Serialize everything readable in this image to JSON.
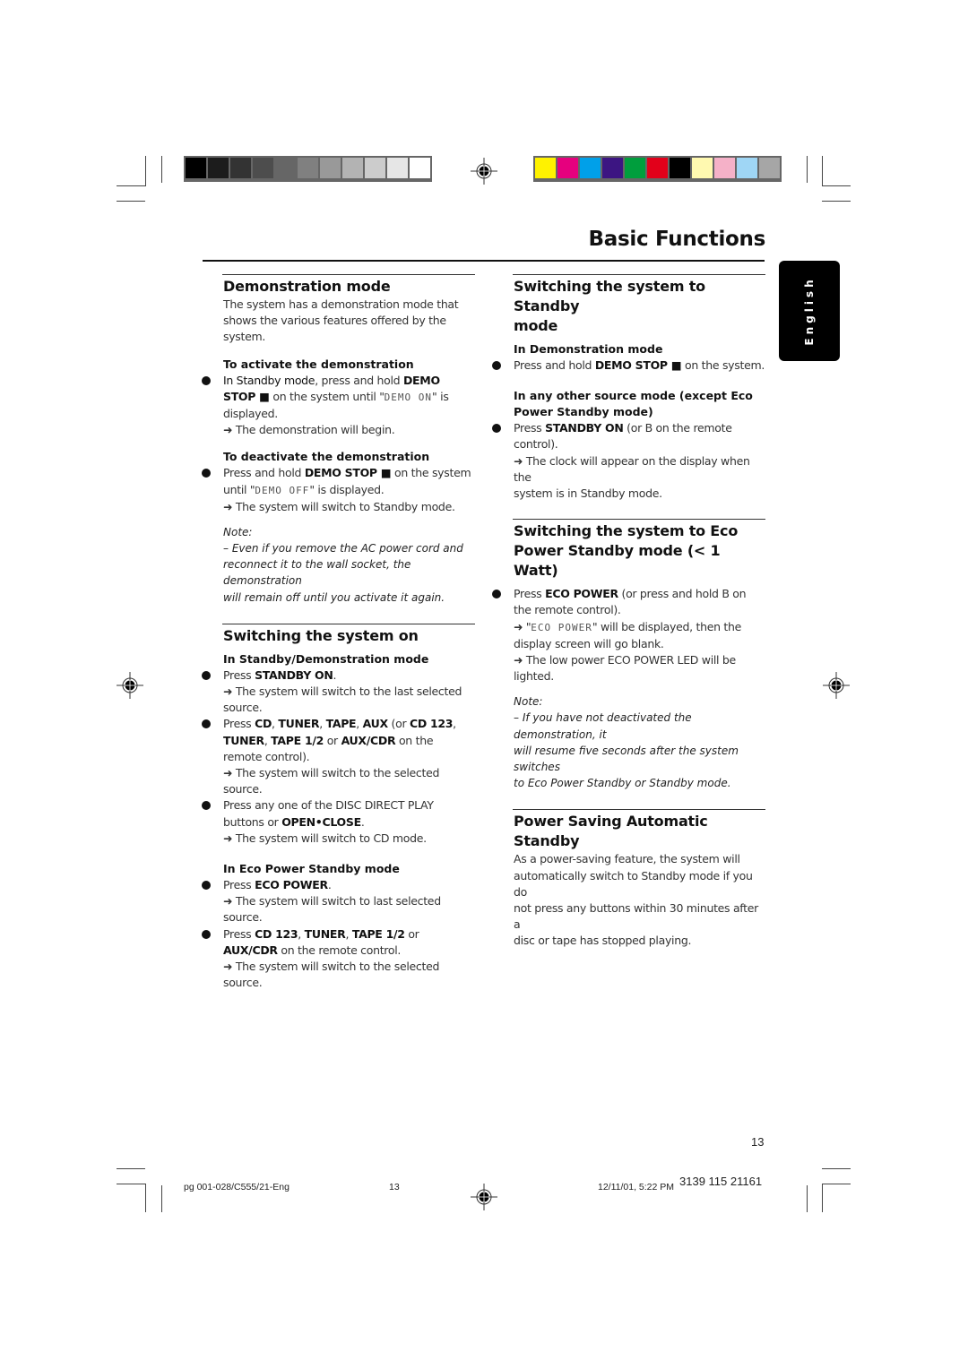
{
  "color_bars": {
    "grayscale": [
      "#000000",
      "#1c1c1c",
      "#333333",
      "#4d4d4d",
      "#666666",
      "#808080",
      "#999999",
      "#b3b3b3",
      "#cccccc",
      "#e6e6e6",
      "#ffffff"
    ],
    "process": [
      "#fff200",
      "#e6007e",
      "#00a0e9",
      "#3c1582",
      "#009e3d",
      "#e2001a",
      "#000000",
      "#fff9b0",
      "#f5b1c8",
      "#9fd6f5",
      "#a6a6a6"
    ]
  },
  "header": {
    "title": "Basic Functions"
  },
  "language_tab": {
    "label": "English"
  },
  "left_column": {
    "demo": {
      "title": "Demonstration mode",
      "intro": [
        "The system has a demonstration mode that",
        "shows the various features offered by the system."
      ],
      "activate": {
        "heading": "To activate the demonstration",
        "line1_a": "In Standby mode",
        "line1_b": ", press and hold ",
        "line1_c": "DEMO",
        "line2_a": "STOP ",
        "line2_b": "■",
        "line2_c": " on the system until \"",
        "line2_lcd": "DEMO ON",
        "line2_d": "\" is",
        "line3": "displayed.",
        "result": "➜ The demonstration will begin."
      },
      "deactivate": {
        "heading": "To deactivate the demonstration",
        "line1_a": "Press and hold ",
        "line1_b": "DEMO STOP ",
        "line1_c": "■",
        "line1_d": " on the system",
        "line2_a": "until \"",
        "line2_lcd": "DEMO OFF",
        "line2_b": "\" is displayed.",
        "result": "➜ The system will switch to Standby mode."
      },
      "note_label": "Note:",
      "note_lines": [
        "–  Even if you remove the AC power cord and",
        "reconnect it to the wall socket, the demonstration",
        "will remain off until you activate it again."
      ]
    },
    "switch_on": {
      "title": "Switching the system on",
      "standby_heading": "In Standby/Demonstration mode",
      "b1_a": "Press ",
      "b1_b": "STANDBY ON",
      "b1_c": ".",
      "b1_result1": "➜ The system will switch to the last selected",
      "b1_result2": "source.",
      "b2_l1_a": "Press ",
      "b2_l1_b": "CD",
      "b2_l1_c": ", ",
      "b2_l1_d": "TUNER",
      "b2_l1_e": ", ",
      "b2_l1_f": "TAPE",
      "b2_l1_g": ", ",
      "b2_l1_h": "AUX",
      "b2_l1_i": " (or ",
      "b2_l1_j": "CD 123",
      "b2_l1_k": ",",
      "b2_l2_a": "TUNER",
      "b2_l2_b": ", ",
      "b2_l2_c": "TAPE 1/2",
      "b2_l2_d": " or ",
      "b2_l2_e": "AUX/CDR",
      "b2_l2_f": " on the",
      "b2_l3": "remote control).",
      "b2_result": "➜ The system will switch to the selected source.",
      "b3_l1": "Press any one of the DISC DIRECT PLAY",
      "b3_l2_a": "buttons or ",
      "b3_l2_b": "OPEN•CLOSE",
      "b3_l2_c": ".",
      "b3_result": "➜ The system will switch to CD mode.",
      "eco_heading": "In Eco Power Standby mode",
      "e1_a": "Press ",
      "e1_b": "ECO POWER",
      "e1_c": ".",
      "e1_result": "➜ The system will switch to last selected source.",
      "e2_l1_a": "Press ",
      "e2_l1_b": "CD 123",
      "e2_l1_c": ", ",
      "e2_l1_d": "TUNER",
      "e2_l1_e": ", ",
      "e2_l1_f": "TAPE 1/2",
      "e2_l1_g": " or",
      "e2_l2_a": "AUX/CDR",
      "e2_l2_b": " on the remote control.",
      "e2_result": "➜ The system will switch to the selected source."
    }
  },
  "right_column": {
    "standby": {
      "title_l1": "Switching the system to Standby",
      "title_l2": "mode",
      "demo_heading": "In Demonstration mode",
      "d1_a": "Press and hold ",
      "d1_b": "DEMO STOP ",
      "d1_c": "■",
      "d1_d": "  on the system.",
      "other_heading_l1": "In any other source mode (except Eco",
      "other_heading_l2": "Power Standby mode)",
      "o1_l1_a": "Press ",
      "o1_l1_b": "STANDBY ON",
      "o1_l1_c": " (or B   on the remote",
      "o1_l2": "control).",
      "o1_result1": "➜ The clock will appear on the display when the",
      "o1_result2": "system is in Standby mode."
    },
    "eco": {
      "title_l1": "Switching the system to Eco",
      "title_l2": "Power Standby mode (< 1 Watt)",
      "b1_l1_a": "Press ",
      "b1_l1_b": "ECO POWER",
      "b1_l1_c": " (or press and hold B   on",
      "b1_l2": "the remote control).",
      "r1_a": "➜ \"",
      "r1_lcd": "ECO POWER",
      "r1_b": "\" will be displayed, then the",
      "r1_l2": "display screen will go blank.",
      "r2_l1": "➜ The low power ECO POWER LED will be",
      "r2_l2": "lighted.",
      "note_label": "Note:",
      "note_lines": [
        "–  If you have not deactivated the demonstration, it",
        "will resume five seconds after the system switches",
        "to Eco Power Standby or Standby mode."
      ]
    },
    "auto_standby": {
      "title": "Power Saving Automatic Standby",
      "lines": [
        "As a power-saving feature, the system will",
        "automatically switch to Standby mode if you do",
        "not press any buttons within 30 minutes after a",
        "disc or tape has stopped playing."
      ]
    }
  },
  "footer": {
    "page_number": "13",
    "file_ref": "pg 001-028/C555/21-Eng",
    "sheet_number": "13",
    "timestamp": "12/11/01, 5:22 PM",
    "code": "3139 115 21161"
  }
}
